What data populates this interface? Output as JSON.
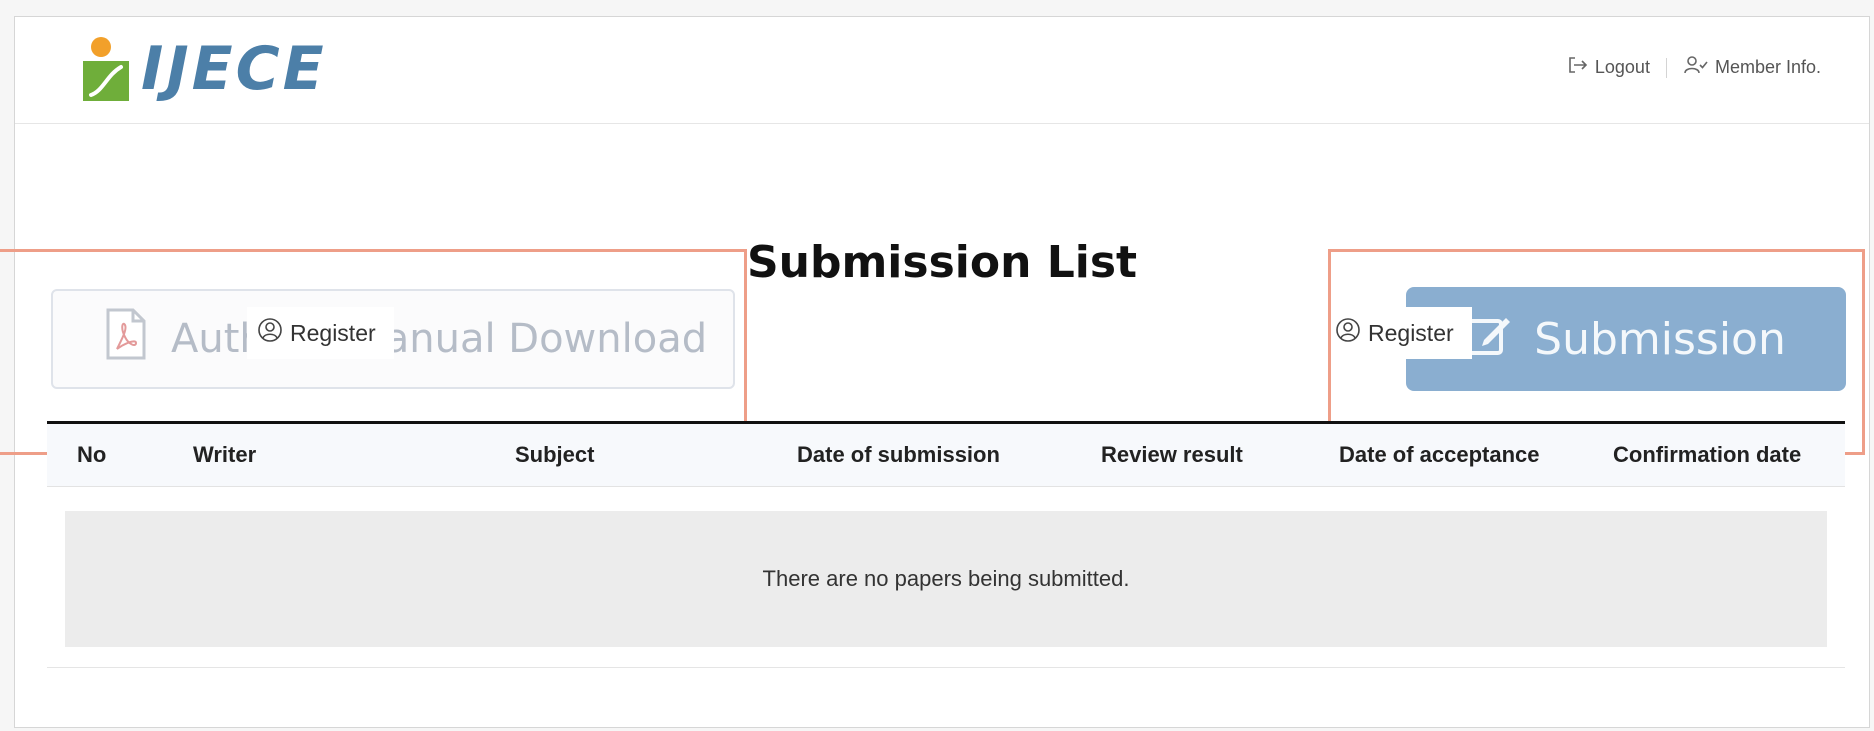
{
  "header": {
    "logo_text": "IJECE",
    "logout_label": "Logout",
    "member_info_label": "Member Info."
  },
  "page": {
    "title": "Submission List"
  },
  "buttons": {
    "manual_download_label": "Author's Manual Download",
    "submission_label": "Submission",
    "register_label": "Register"
  },
  "table": {
    "columns": [
      "No",
      "Writer",
      "Subject",
      "Date of submission",
      "Review result",
      "Date of acceptance",
      "Confirmation date"
    ],
    "empty_message": "There are no papers being submitted."
  },
  "colors": {
    "brand_blue": "#4c7fa8",
    "brand_green": "#6fae3a",
    "brand_orange": "#f2a02a",
    "submission_button": "#8aaed0",
    "highlight": "#ee9e88"
  }
}
